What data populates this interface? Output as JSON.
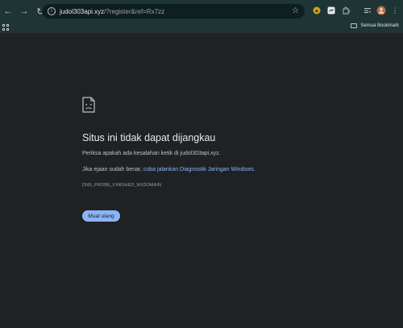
{
  "browser": {
    "url_host": "judol303api.xyz",
    "url_path": "/?register&ref=Rx7zz",
    "bookmarks_folder": "Semua Bookmark"
  },
  "error": {
    "title": "Situs ini tidak dapat dijangkau",
    "message1": "Periksa apakah ada kesalahan ketik di judol303api.xyz.",
    "message2_prefix": "Jika ejaan sudah benar, ",
    "message2_link": "coba jalankan Diagnostik Jaringan Windows",
    "message2_suffix": ".",
    "code": "DNS_PROBE_FINISHED_NXDOMAIN",
    "reload_label": "Muat ulang"
  },
  "colors": {
    "accent": "#8ab4f8",
    "background": "#202124",
    "toolbar": "#1f3535"
  }
}
